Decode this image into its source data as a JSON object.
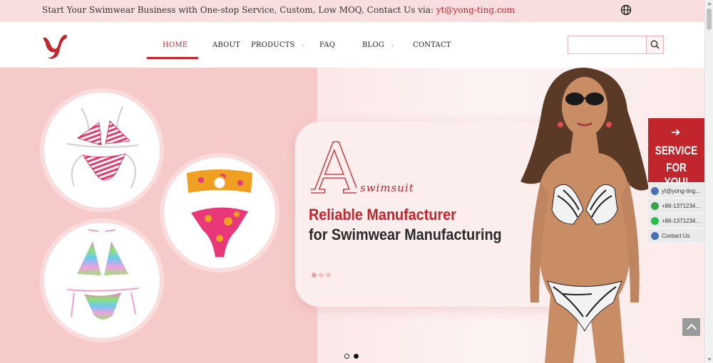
{
  "topbar": {
    "text": "Start Your Swimwear Business with One-stop Service, Custom, Low MOQ, Contact Us via: ",
    "email": "yt@yong-ting.com",
    "globe_icon": "globe-icon"
  },
  "header": {
    "logo_icon": "yt-logo",
    "nav": [
      {
        "label": "HOME",
        "active": true,
        "dropdown": false
      },
      {
        "label": "ABOUT",
        "active": false,
        "dropdown": false
      },
      {
        "label": "PRODUCTS",
        "active": false,
        "dropdown": true
      },
      {
        "label": "FAQ",
        "active": false,
        "dropdown": false
      },
      {
        "label": "BLOG",
        "active": false,
        "dropdown": true
      },
      {
        "label": "CONTACT",
        "active": false,
        "dropdown": false
      }
    ],
    "search": {
      "placeholder": "",
      "value": "",
      "icon": "search-icon"
    }
  },
  "hero": {
    "big_letter": "A",
    "script_text": "swimsuit",
    "headline_1": "Reliable Manufacturer",
    "headline_2": "for Swimwear Manufacturing",
    "card_dots": 3,
    "slider_dots": 2,
    "slider_active": 1
  },
  "side_widget": {
    "service_line_1": "SERVICE",
    "service_line_2": "FOR YOU!",
    "arrow_icon": "arrow-right-icon",
    "items": [
      {
        "icon": "email-icon",
        "text": "yt@yong-ting...",
        "color": "#4a6fb5"
      },
      {
        "icon": "phone-icon",
        "text": "+86-137123467...",
        "color": "#3aa04a"
      },
      {
        "icon": "whatsapp-icon",
        "text": "+86-137123467...",
        "color": "#25c04a"
      },
      {
        "icon": "contact-icon",
        "text": "Contact Us",
        "color": "#4a6fb5"
      }
    ]
  },
  "colors": {
    "brand_red": "#c0262c",
    "topbar_bg": "#f8dede",
    "hero_pink": "#f7caca"
  }
}
